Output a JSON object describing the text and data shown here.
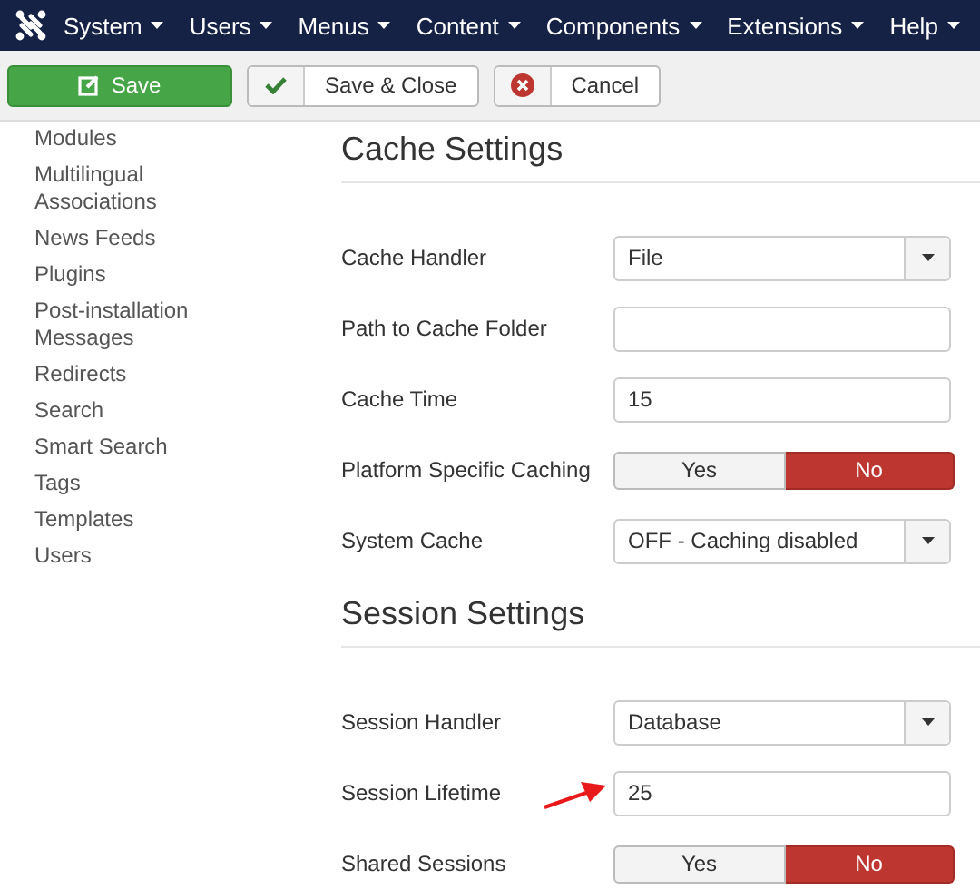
{
  "navbar": {
    "menus": [
      {
        "label": "System"
      },
      {
        "label": "Users"
      },
      {
        "label": "Menus"
      },
      {
        "label": "Content"
      },
      {
        "label": "Components"
      },
      {
        "label": "Extensions"
      },
      {
        "label": "Help"
      }
    ]
  },
  "toolbar": {
    "buttons": [
      {
        "kind": "save",
        "label": "Save"
      },
      {
        "kind": "save-close",
        "label": "Save & Close"
      },
      {
        "kind": "cancel",
        "label": "Cancel"
      }
    ]
  },
  "sidebar": {
    "items": [
      {
        "label": "Modules"
      },
      {
        "label": "Multilingual Associations"
      },
      {
        "label": "News Feeds"
      },
      {
        "label": "Plugins"
      },
      {
        "label": "Post-installation Messages"
      },
      {
        "label": "Redirects"
      },
      {
        "label": "Search"
      },
      {
        "label": "Smart Search"
      },
      {
        "label": "Tags"
      },
      {
        "label": "Templates"
      },
      {
        "label": "Users"
      }
    ]
  },
  "sections": [
    {
      "title": "Cache Settings",
      "fields": [
        {
          "label": "Cache Handler",
          "kind": "select",
          "value": "File"
        },
        {
          "label": "Path to Cache Folder",
          "kind": "text"
        },
        {
          "label": "Cache Time",
          "kind": "text",
          "value": "15"
        },
        {
          "label": "Platform Specific Caching",
          "kind": "toggle",
          "options": [
            {
              "label": "Yes",
              "selected": false
            },
            {
              "label": "No",
              "selected": true
            }
          ]
        },
        {
          "label": "System Cache",
          "kind": "select",
          "value": "OFF - Caching disabled"
        }
      ]
    },
    {
      "title": "Session Settings",
      "fields": [
        {
          "label": "Session Handler",
          "kind": "select",
          "value": "Database"
        },
        {
          "label": "Session Lifetime",
          "kind": "text",
          "value": "25",
          "pointer": true
        },
        {
          "label": "Shared Sessions",
          "kind": "toggle",
          "options": [
            {
              "label": "Yes",
              "selected": false
            },
            {
              "label": "No",
              "selected": true
            }
          ]
        }
      ]
    }
  ]
}
